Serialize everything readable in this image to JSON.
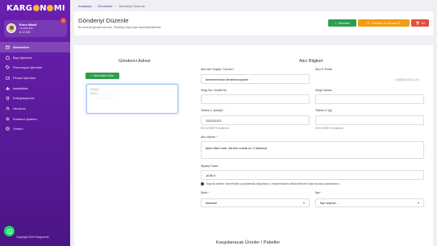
{
  "brand": {
    "logo_pre": "KARG",
    "logo_post": "N",
    "logo_end": "MI"
  },
  "user": {
    "name": "Emre Masit",
    "sub": "1234567890",
    "balance": "₺ 12.150",
    "notifications": "0"
  },
  "sidebar": {
    "items": [
      {
        "label": "Gönderiler",
        "icon": "box-icon",
        "active": true
      },
      {
        "label": "Bayi İşlemleri",
        "icon": "store-icon"
      },
      {
        "label": "Promosyon İşlemleri",
        "icon": "tag-icon"
      },
      {
        "label": "Finans İşlemleri",
        "icon": "wallet-icon"
      },
      {
        "label": "İstatistikler",
        "icon": "chart-icon"
      },
      {
        "label": "Entegrasyonlar",
        "icon": "plug-icon"
      },
      {
        "label": "Hesabım",
        "icon": "user-icon"
      },
      {
        "label": "Kullanıcı Ayarları",
        "icon": "gear-icon"
      },
      {
        "label": "Yardım",
        "icon": "help-icon"
      }
    ],
    "copyright": "Copyright 2023 Kargonomi"
  },
  "breadcrumb": {
    "home": "Anasayfa",
    "shipments": "Gönderiler",
    "current": "Gönderiyi Düzenle"
  },
  "header": {
    "title": "Gönderiyi Düzenle",
    "description": "Bu ekranda gönderi durumu, Tedarikçi veya kaydı düzenleyebilirsiniz"
  },
  "actions": {
    "update": "Güncelle",
    "update_new": "Güncelle ve Devam Et",
    "delete": "Sil"
  },
  "sender": {
    "title": "Gönderici Adresi",
    "add_button": "+ Yeni Adres Ekle",
    "address_lines": [
      "Merkez",
      "Adres: ... ... ... ... ... ...",
      "... ... ... ... ... ... ... ... ..."
    ]
  },
  "recipient": {
    "title": "Alıcı Bilgileri",
    "name_label": "Alıcı Adı Soyadı / Ünvanı",
    "name_value": "denememsim denemesoyisim",
    "email_label": "Alıcı E-Posta",
    "email_value": "mail@ornek.com",
    "tax_id_label": "Vergi No / Kimlik No",
    "tax_id_value": "",
    "tax_office_label": "Vergi Dairesi",
    "tax_office_value": "",
    "phone1_label": "Telefon 1 (Mobil)",
    "phone1_value": "1111111111",
    "phone1_hint": "5XX1234567 formatında",
    "phone2_label": "Telefon 2 (İş)",
    "phone2_value": "",
    "phone2_hint": "5XX1234567 formatında",
    "address_label": "Alıcı Adresi",
    "address_value": "falan filan mah. sitroen sokak no 3 İstanbul",
    "order_total_label": "Sipariş Tutarı",
    "order_total_value": "1046.9",
    "info_note": "Kapıda ödeme hizmetinden yararlanmak istiyorsanız, müşterimizden tahsil edilecek tutarı burada yazmalısınız",
    "city_label": "Şehir",
    "city_value": "İstanbul",
    "district_label": "İlçe",
    "district_value": "İlçe seçiniz ..."
  },
  "products": {
    "title": "Kargolanacak Ürünler / Paketler"
  }
}
